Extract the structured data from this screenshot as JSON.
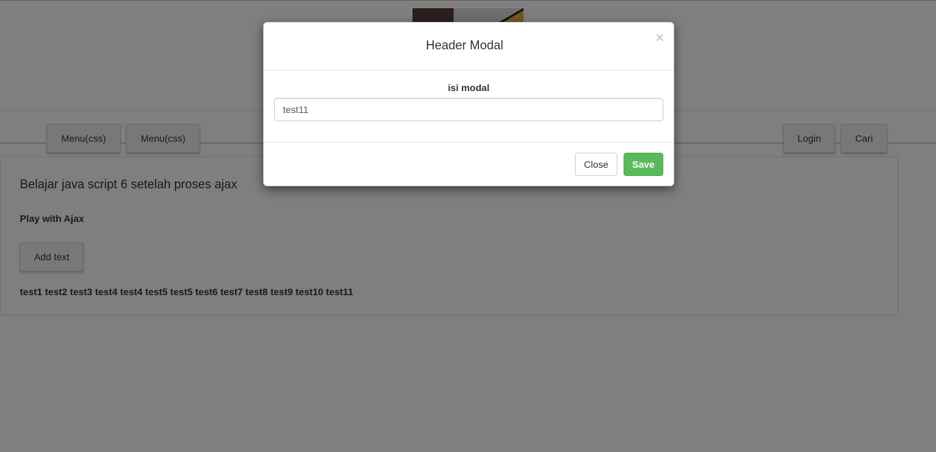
{
  "nav": {
    "left_items": [
      {
        "label": "Menu(css)"
      },
      {
        "label": "Menu(css)"
      }
    ],
    "right_items": [
      {
        "label": "Login"
      },
      {
        "label": "Cari"
      }
    ]
  },
  "panel": {
    "title": "Belajar java script 6 setelah proses ajax",
    "subtitle": "Play with Ajax",
    "add_button_label": "Add text",
    "results_text": "test1 test2 test3 test4 test4 test5 test5 test6 test7 test8 test9 test10 test11"
  },
  "modal": {
    "title": "Header Modal",
    "close_glyph": "×",
    "field_label": "isi modal",
    "field_value": "test11",
    "close_button_label": "Close",
    "save_button_label": "Save"
  }
}
